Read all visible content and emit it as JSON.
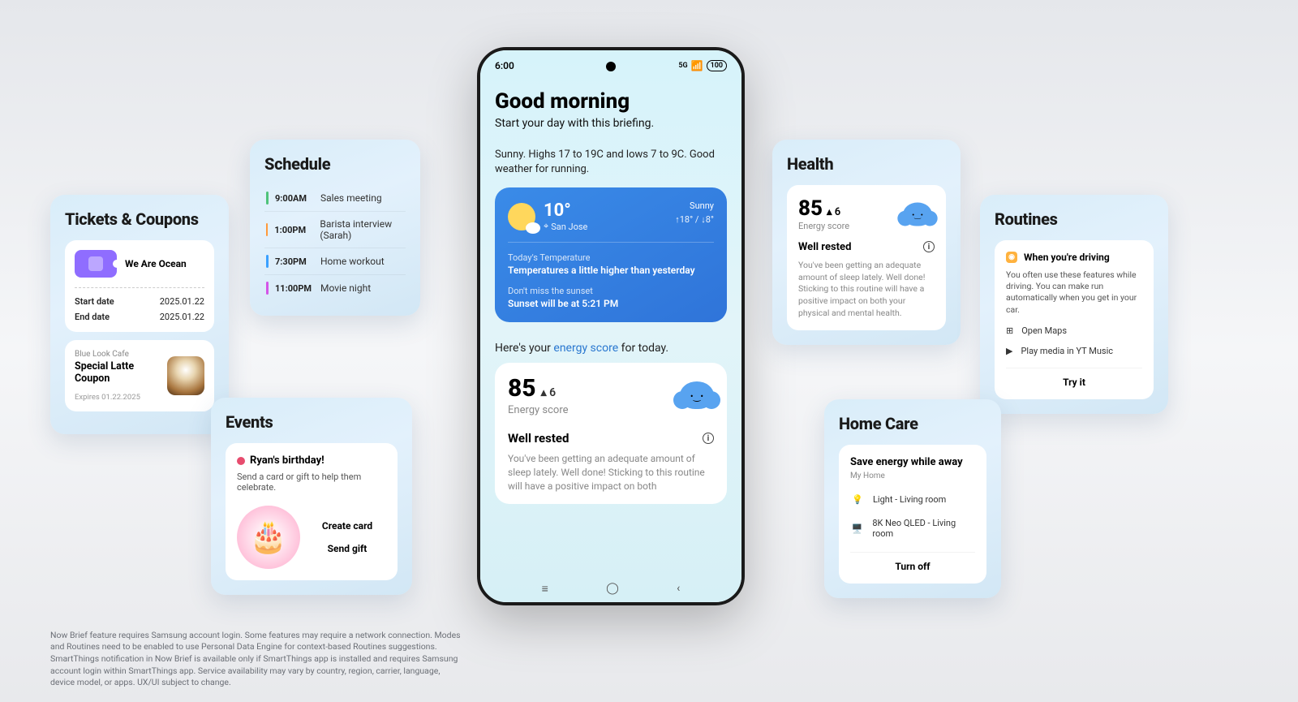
{
  "tickets": {
    "title": "Tickets & Coupons",
    "ticket_name": "We Are Ocean",
    "start_label": "Start date",
    "start_value": "2025.01.22",
    "end_label": "End date",
    "end_value": "2025.01.22",
    "coupon_brand": "Blue Look Cafe",
    "coupon_name": "Special Latte Coupon",
    "coupon_expires": "Expires 01.22.2025"
  },
  "schedule": {
    "title": "Schedule",
    "items": [
      {
        "time": "9:00AM",
        "label": "Sales meeting",
        "color": "#4fc37a"
      },
      {
        "time": "1:00PM",
        "label": "Barista interview (Sarah)",
        "color": "#ff993a"
      },
      {
        "time": "7:30PM",
        "label": "Home workout",
        "color": "#3aa0ff"
      },
      {
        "time": "11:00PM",
        "label": "Movie night",
        "color": "#d455e8"
      }
    ]
  },
  "events": {
    "title": "Events",
    "event_name": "Ryan's birthday!",
    "event_desc": "Send a card or gift to help them celebrate.",
    "create_card": "Create card",
    "send_gift": "Send gift"
  },
  "phone": {
    "time": "6:00",
    "battery": "100",
    "greeting": "Good morning",
    "subtitle": "Start your day with this briefing.",
    "weather_summary": "Sunny. Highs 17 to 19C and lows 7 to 9C. Good weather for running.",
    "temp": "10°",
    "location": "San Jose",
    "condition": "Sunny",
    "hilo": "↑18° / ↓8°",
    "today_label": "Today's Temperature",
    "today_val": "Temperatures a little higher than yesterday",
    "sunset_label": "Don't miss the sunset",
    "sunset_val": "Sunset will be at 5:21 PM",
    "line2a": "Here's your ",
    "line2link": "energy score",
    "line2b": " for today.",
    "energy_score": "85",
    "energy_trend": "6",
    "energy_label": "Energy score",
    "well_title": "Well rested",
    "well_desc": "You've been getting an adequate amount of sleep lately. Well done! Sticking to this routine will have a positive impact on both"
  },
  "health": {
    "title": "Health",
    "score": "85",
    "trend": "6",
    "label": "Energy score",
    "well_title": "Well rested",
    "desc": "You've been getting an adequate amount of sleep lately. Well done! Sticking to this routine will have a positive impact on both your physical and mental health."
  },
  "routines": {
    "title": "Routines",
    "sub_title": "When you're driving",
    "desc": "You often use these features while driving. You can make run automatically when you get in your car.",
    "items": [
      "Open Maps",
      "Play media in YT Music"
    ],
    "button": "Try it"
  },
  "homecare": {
    "title": "Home Care",
    "sub_title": "Save energy while away",
    "my_home": "My Home",
    "items": [
      "Light - Living room",
      "8K Neo QLED - Living room"
    ],
    "button": "Turn off"
  },
  "footer": "Now Brief feature requires Samsung account login. Some features may require a network connection. Modes and Routines need to be enabled to use Personal Data Engine for context-based Routines suggestions. SmartThings notification in Now Brief is available only if SmartThings app is installed and requires Samsung account login within SmartThings app. Service availability may vary by country, region, carrier, language, device model, or apps. UX/UI subject to change."
}
